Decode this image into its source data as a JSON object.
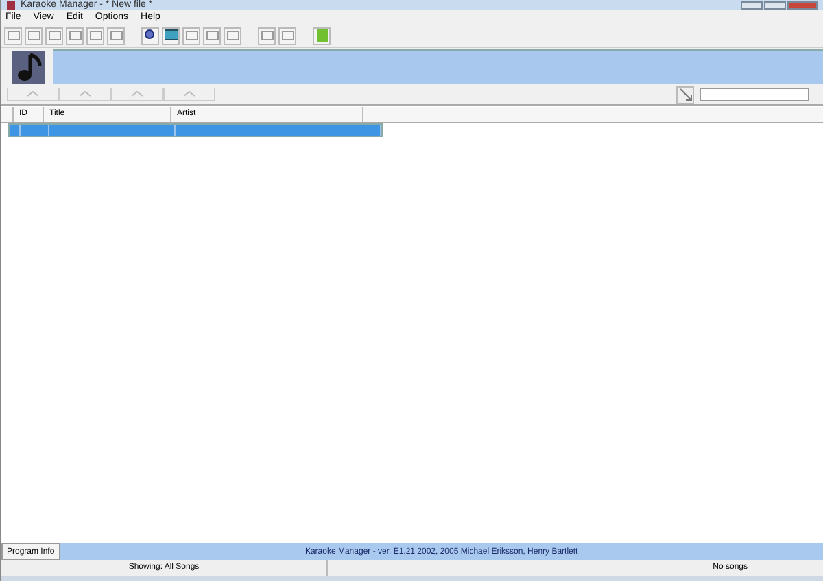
{
  "window": {
    "title": "Karaoke Manager - * New file *"
  },
  "menu": [
    "File",
    "View",
    "Edit",
    "Options",
    "Help"
  ],
  "table": {
    "columns": [
      "ID",
      "Title",
      "Artist"
    ],
    "rows": [
      {
        "selected": true
      }
    ]
  },
  "program_info_button": "Program Info",
  "credits": "Karaoke Manager - ver. E1.21 2002, 2005 Michael Eriksson, Henry Bartlett",
  "status_bar": {
    "showing": "Showing: All Songs",
    "count": "No songs"
  }
}
